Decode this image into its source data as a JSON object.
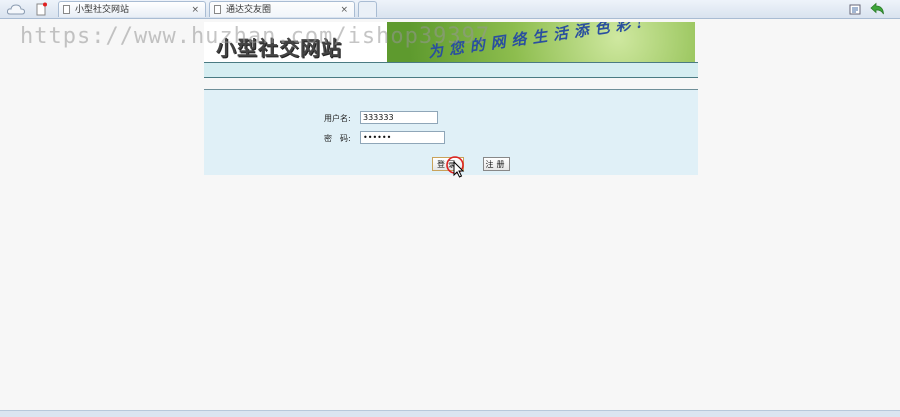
{
  "browser": {
    "tabs": [
      {
        "title": "小型社交网站"
      },
      {
        "title": "通达交友圈"
      }
    ],
    "close_glyph": "×"
  },
  "watermark": "https://www.huzhan.com/ishop39397",
  "banner": {
    "logo_text": "小型社交网站",
    "slogan": "为您的网络生活添色彩!"
  },
  "login": {
    "username_label": "用户名:",
    "username_value": "333333",
    "password_label": "密　码:",
    "password_value": "••••••",
    "login_button": "登录",
    "register_button": "注册"
  },
  "colors": {
    "panel_bg": "#e0f0f7",
    "nav_strip": "#d5edf1",
    "slogan": "#2a4f9f",
    "banner_green": "#8dbd4e"
  },
  "icons": {
    "home": "cloud-home-icon",
    "sidebar": "sidebar-icon",
    "document": "document-icon",
    "page_tools": "page-tools-icon",
    "back": "back-arrow-icon",
    "cursor": "mouse-cursor-icon"
  }
}
